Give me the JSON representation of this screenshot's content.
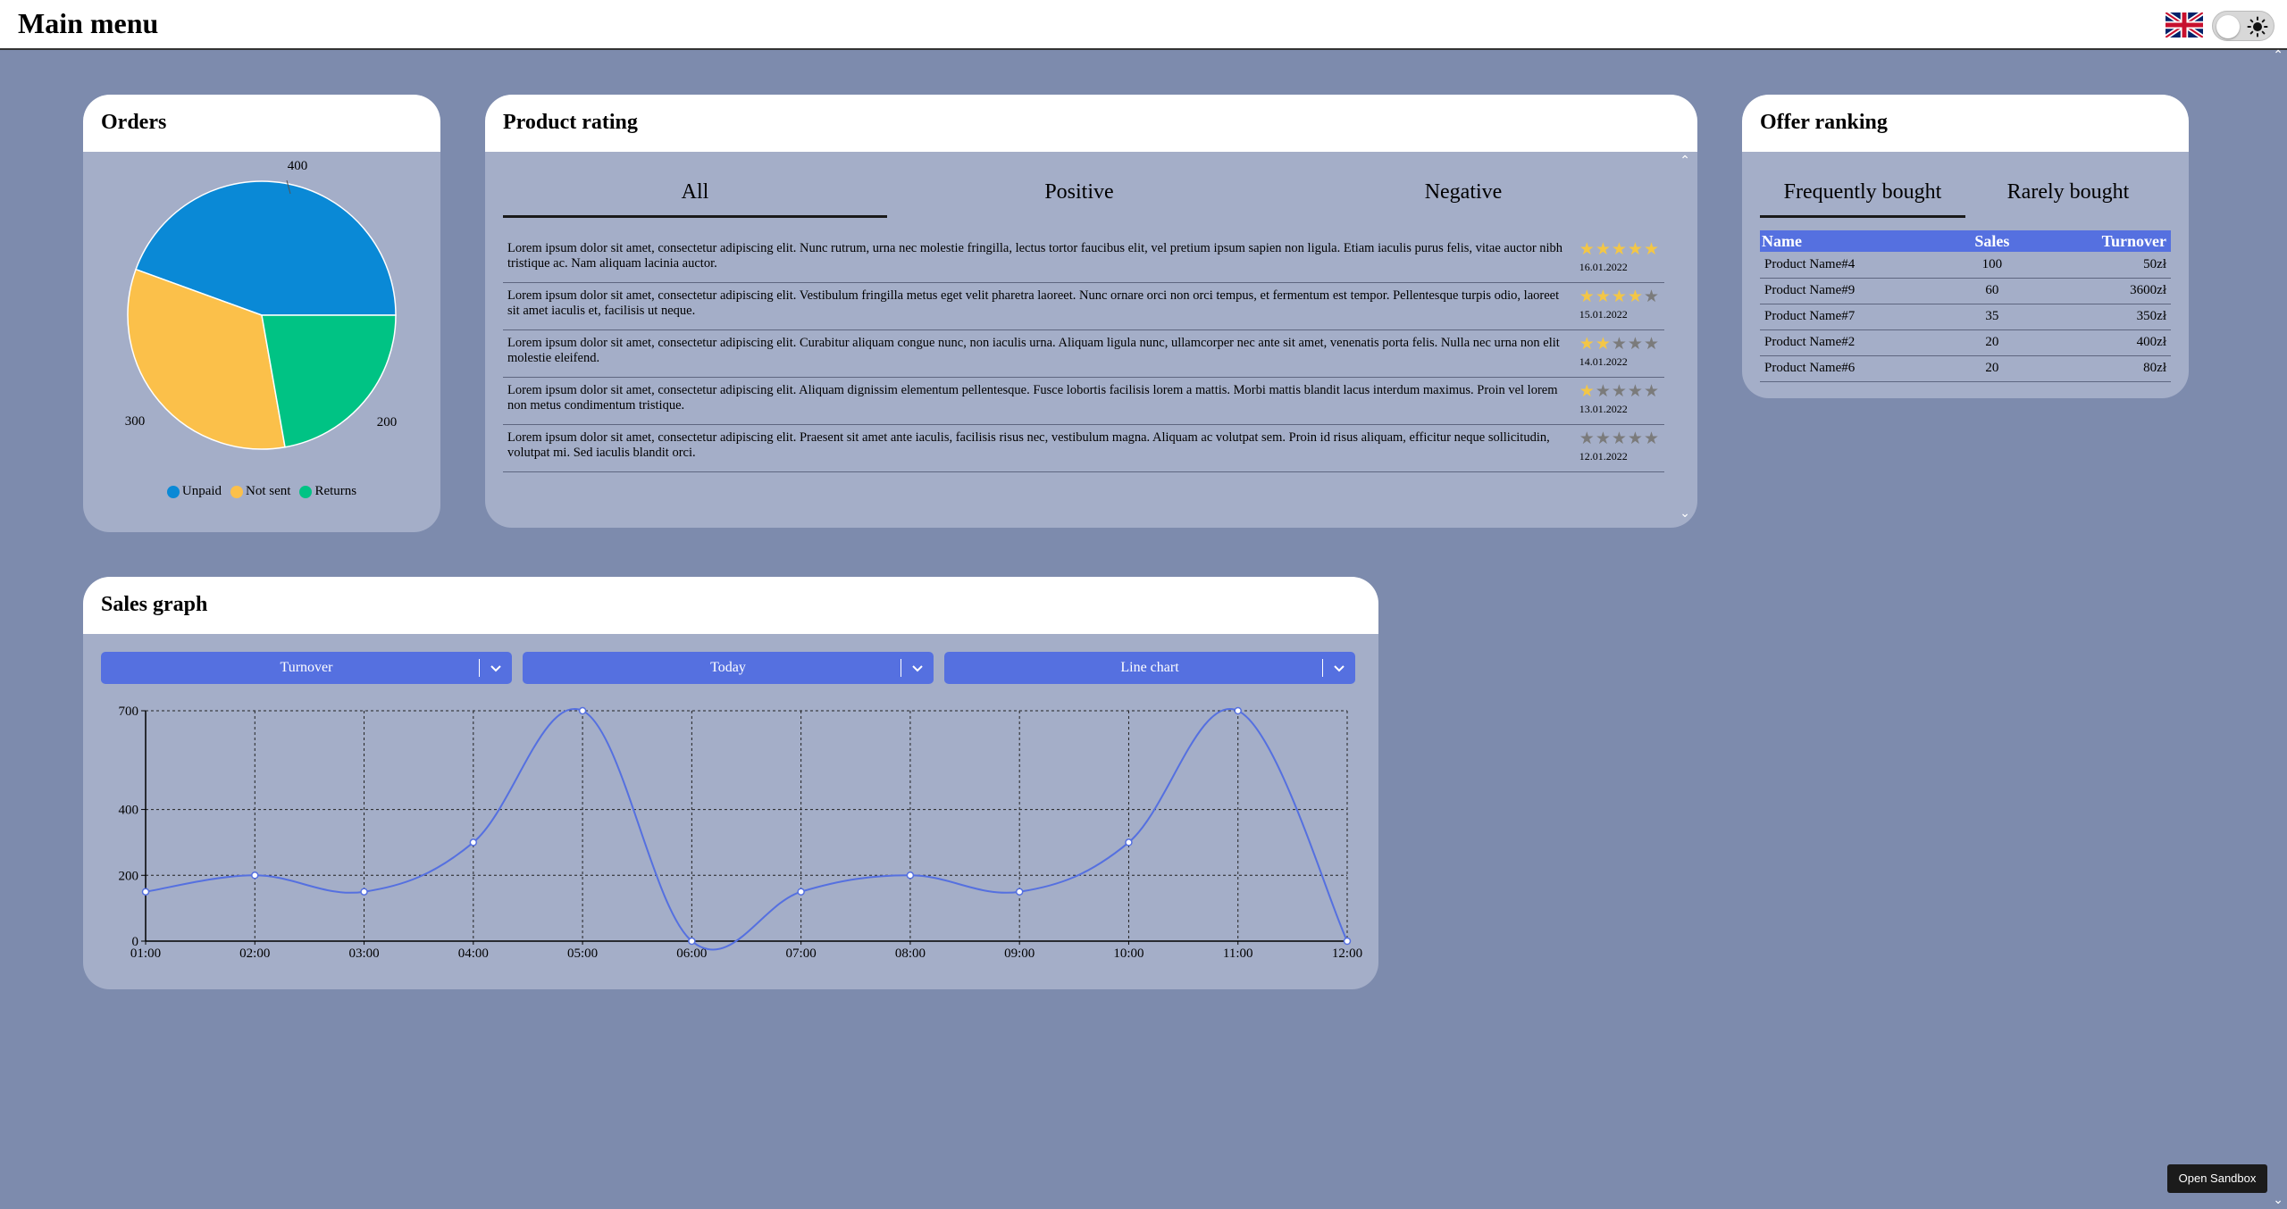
{
  "header": {
    "title": "Main menu",
    "flag_icon": "uk-flag-icon",
    "theme_toggle_icon": "sun-icon"
  },
  "orders": {
    "title": "Orders",
    "chart_data": {
      "type": "pie",
      "categories": [
        "Unpaid",
        "Not sent",
        "Returns"
      ],
      "values": [
        400,
        300,
        200
      ],
      "colors": [
        "#0a89d6",
        "#fbc04a",
        "#00c384"
      ],
      "legend_position": "bottom"
    }
  },
  "rating": {
    "title": "Product rating",
    "tabs": [
      {
        "label": "All",
        "active": true
      },
      {
        "label": "Positive",
        "active": false
      },
      {
        "label": "Negative",
        "active": false
      }
    ],
    "reviews": [
      {
        "text": "Lorem ipsum dolor sit amet, consectetur adipiscing elit. Nunc rutrum, urna nec molestie fringilla, lectus tortor faucibus elit, vel pretium ipsum sapien non ligula. Etiam iaculis purus felis, vitae auctor nibh tristique ac. Nam aliquam lacinia auctor.",
        "stars": 5,
        "date": "16.01.2022"
      },
      {
        "text": "Lorem ipsum dolor sit amet, consectetur adipiscing elit. Vestibulum fringilla metus eget velit pharetra laoreet. Nunc ornare orci non orci tempus, et fermentum est tempor. Pellentesque turpis odio, laoreet sit amet iaculis et, facilisis ut neque.",
        "stars": 4,
        "date": "15.01.2022"
      },
      {
        "text": "Lorem ipsum dolor sit amet, consectetur adipiscing elit. Curabitur aliquam congue nunc, non iaculis urna. Aliquam ligula nunc, ullamcorper nec ante sit amet, venenatis porta felis. Nulla nec urna non elit molestie eleifend.",
        "stars": 2,
        "date": "14.01.2022"
      },
      {
        "text": "Lorem ipsum dolor sit amet, consectetur adipiscing elit. Aliquam dignissim elementum pellentesque. Fusce lobortis facilisis lorem a mattis. Morbi mattis blandit lacus interdum maximus. Proin vel lorem non metus condimentum tristique.",
        "stars": 1,
        "date": "13.01.2022"
      },
      {
        "text": "Lorem ipsum dolor sit amet, consectetur adipiscing elit. Praesent sit amet ante iaculis, facilisis risus nec, vestibulum magna. Aliquam ac volutpat sem. Proin id risus aliquam, efficitur neque sollicitudin, volutpat mi. Sed iaculis blandit orci.",
        "stars": 0,
        "date": "12.01.2022"
      }
    ]
  },
  "ranking": {
    "title": "Offer ranking",
    "tabs": [
      {
        "label": "Frequently bought",
        "active": true
      },
      {
        "label": "Rarely bought",
        "active": false
      }
    ],
    "columns": [
      "Name",
      "Sales",
      "Turnover"
    ],
    "rows": [
      [
        "Product Name#4",
        "100",
        "50zł"
      ],
      [
        "Product Name#9",
        "60",
        "3600zł"
      ],
      [
        "Product Name#7",
        "35",
        "350zł"
      ],
      [
        "Product Name#2",
        "20",
        "400zł"
      ],
      [
        "Product Name#6",
        "20",
        "80zł"
      ]
    ]
  },
  "sales": {
    "title": "Sales graph",
    "selects": [
      {
        "value": "Turnover"
      },
      {
        "value": "Today"
      },
      {
        "value": "Line chart"
      }
    ],
    "chart_data": {
      "type": "line",
      "x": [
        "01:00",
        "02:00",
        "03:00",
        "04:00",
        "05:00",
        "06:00",
        "07:00",
        "08:00",
        "09:00",
        "10:00",
        "11:00",
        "12:00"
      ],
      "series": [
        {
          "values": [
            150,
            200,
            150,
            300,
            700,
            0,
            150,
            200,
            150,
            300,
            700,
            0
          ],
          "color": "#5570e0"
        }
      ],
      "yticks": [
        0,
        200,
        400,
        700
      ],
      "ylim": [
        0,
        700
      ],
      "grid": true
    }
  },
  "footer": {
    "sandbox_label": "Open Sandbox"
  }
}
